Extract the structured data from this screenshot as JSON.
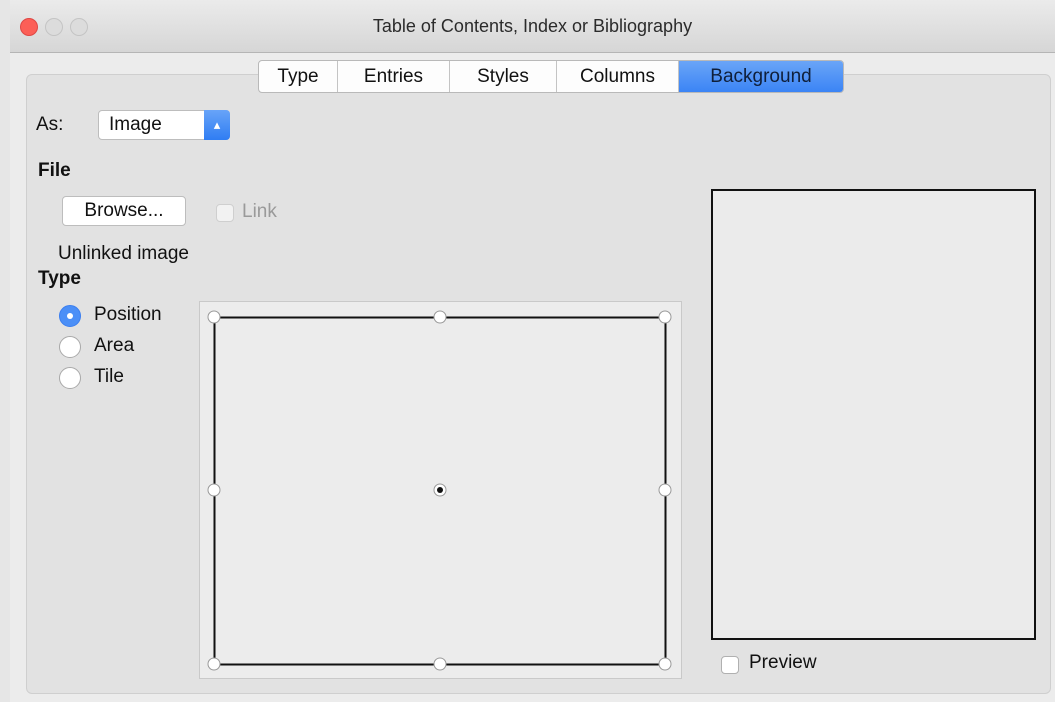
{
  "window": {
    "title": "Table of Contents, Index or Bibliography"
  },
  "tabs": [
    {
      "label": "Type",
      "active": false
    },
    {
      "label": "Entries",
      "active": false
    },
    {
      "label": "Styles",
      "active": false
    },
    {
      "label": "Columns",
      "active": false
    },
    {
      "label": "Background",
      "active": true
    }
  ],
  "as": {
    "label": "As:",
    "selected": "Image"
  },
  "file": {
    "heading": "File",
    "browse_label": "Browse...",
    "link_label": "Link",
    "link_checked": false,
    "status": "Unlinked image"
  },
  "type": {
    "heading": "Type",
    "options": [
      {
        "label": "Position",
        "selected": true
      },
      {
        "label": "Area",
        "selected": false
      },
      {
        "label": "Tile",
        "selected": false
      }
    ]
  },
  "preview": {
    "label": "Preview",
    "checked": false
  },
  "colors": {
    "accent": "#3b84f5",
    "close": "#fc5f57"
  }
}
